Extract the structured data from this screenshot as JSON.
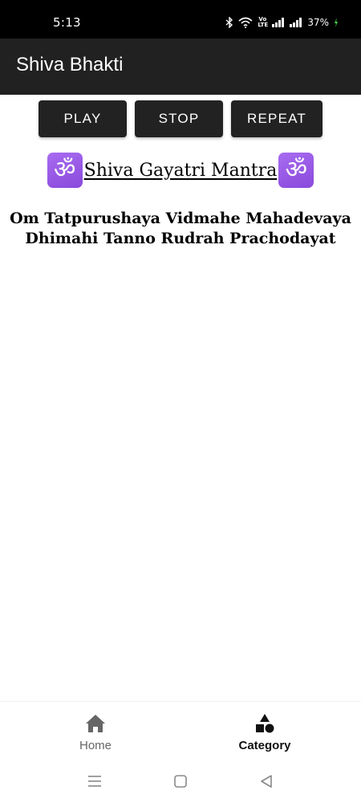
{
  "status_bar": {
    "time": "5:13",
    "volte_line1": "Vo",
    "volte_line2": "LTE",
    "battery": "37%",
    "icons": [
      "bluetooth-icon",
      "wifi-icon",
      "volte-icon",
      "signal-icon",
      "signal-icon",
      "battery-charging-icon"
    ]
  },
  "app_bar": {
    "title": "Shiva Bhakti"
  },
  "controls": {
    "play_label": "PLAY",
    "stop_label": "STOP",
    "repeat_label": "REPEAT"
  },
  "mantra": {
    "symbol": "ॐ",
    "title": "Shiva Gayatri Mantra",
    "text": "Om Tatpurushaya Vidmahe Mahadevaya Dhimahi Tanno Rudrah Prachodayat"
  },
  "bottom_nav": {
    "items": [
      {
        "label": "Home",
        "icon": "home-icon",
        "selected": false
      },
      {
        "label": "Category",
        "icon": "category-icon",
        "selected": true
      }
    ]
  },
  "system_nav": {
    "icons": [
      "recents-icon",
      "home-circle-icon",
      "back-icon"
    ]
  },
  "colors": {
    "status_bar": "#000000",
    "app_bar": "#212121",
    "button": "#222222",
    "om_badge": "#9b59e6",
    "nav_selected": "#111111",
    "nav_unselected": "#666666"
  }
}
